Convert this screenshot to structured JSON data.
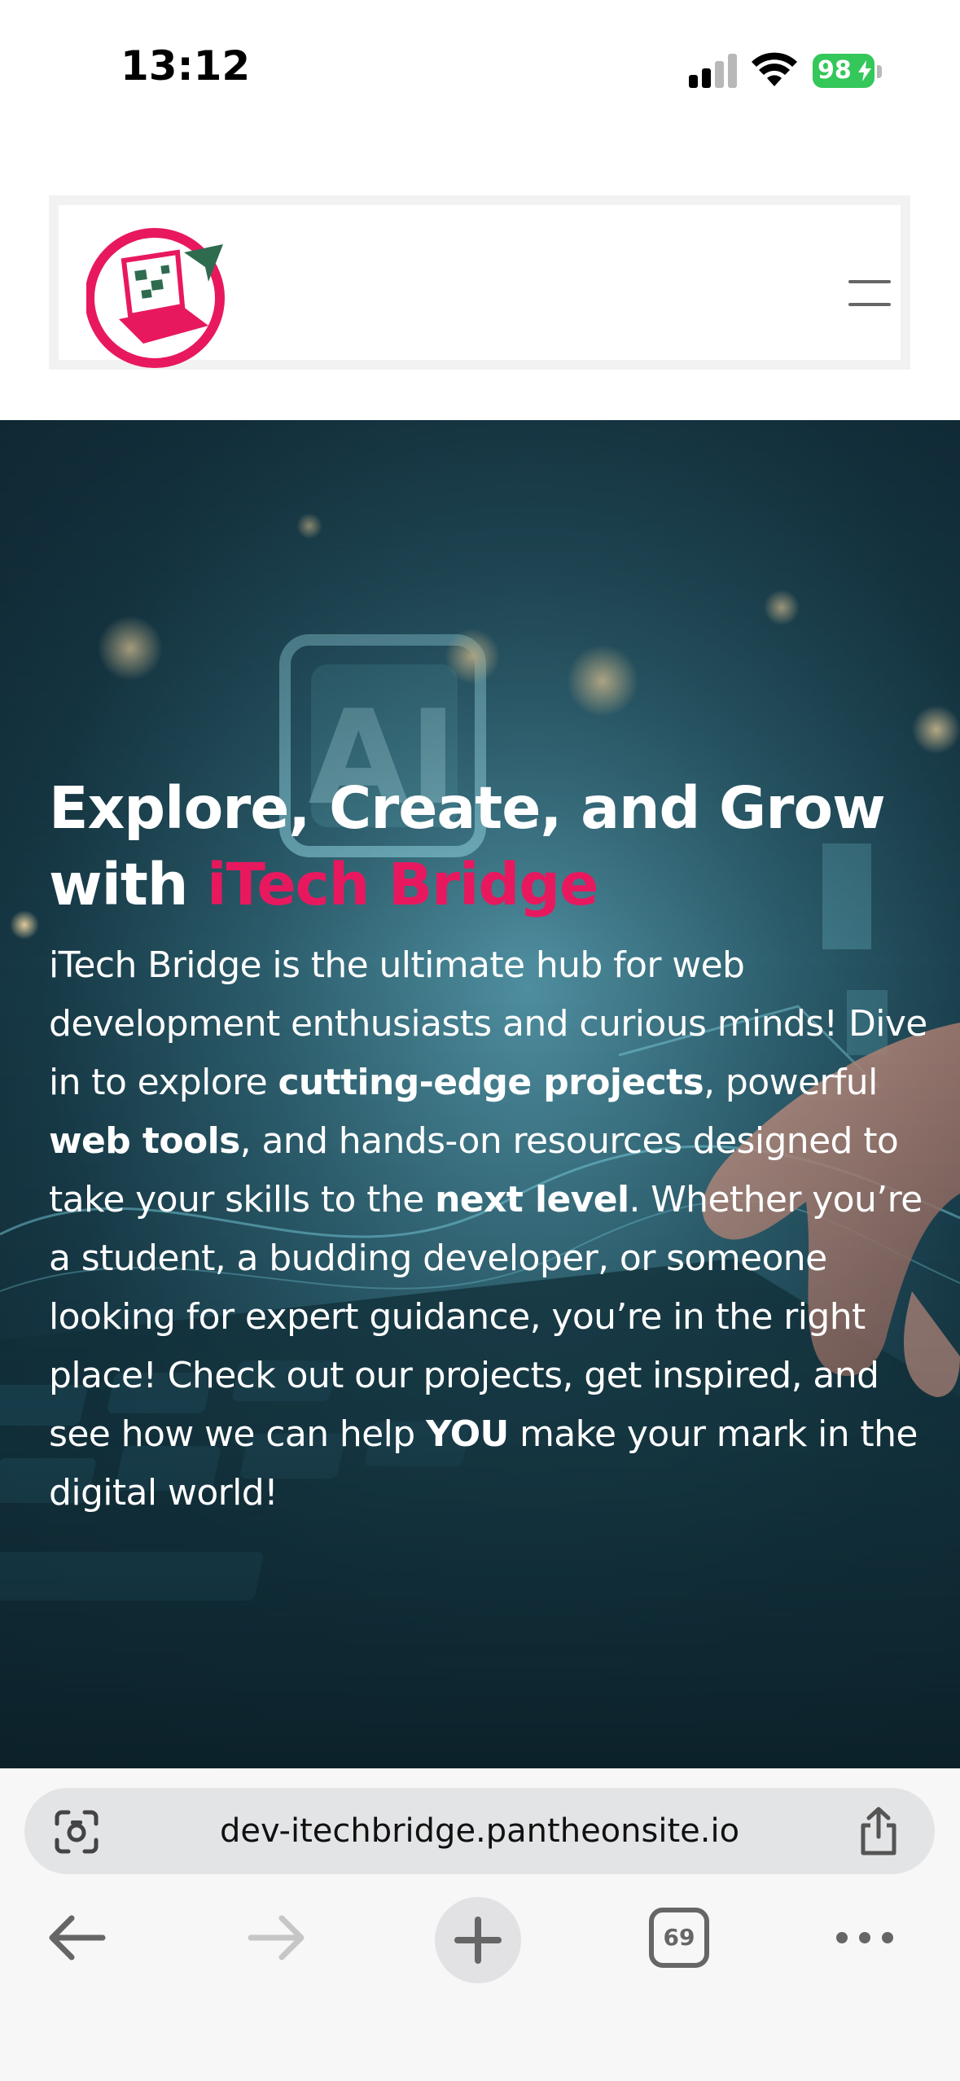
{
  "status_bar": {
    "time": "13:12",
    "battery": "98"
  },
  "header": {
    "logo": "itech-bridge-logo",
    "menu_icon": "hamburger-icon"
  },
  "hero": {
    "title_line1": "Explore, Create, and Grow",
    "title_with": "with ",
    "title_brand": "iTech Bridge",
    "description": [
      {
        "text": "iTech Bridge is the ultimate hub for web development enthusiasts and curious minds! Dive in to explore ",
        "bold": false
      },
      {
        "text": "cutting-edge projects",
        "bold": true
      },
      {
        "text": ", powerful ",
        "bold": false
      },
      {
        "text": "web tools",
        "bold": true
      },
      {
        "text": ", and hands-on resources designed to take your skills to the ",
        "bold": false
      },
      {
        "text": "next level",
        "bold": true
      },
      {
        "text": ". Whether you’re a student, a budding developer, or someone looking for expert guidance, you’re in the right place! Check out our projects, get inspired, and see how we can help ",
        "bold": false
      },
      {
        "text": "YOU",
        "bold": true
      },
      {
        "text": " make your mark in the digital world!",
        "bold": false
      }
    ]
  },
  "browser": {
    "url": "dev-itechbridge.pantheonsite.io",
    "tab_count": "69",
    "icons": [
      "scan-icon",
      "share-icon",
      "back-arrow-icon",
      "forward-arrow-icon",
      "new-tab-icon",
      "tabs-icon",
      "more-icon"
    ]
  },
  "colors": {
    "brand_pink": "#e8185f",
    "brand_green": "#2e6b4f",
    "battery_green": "#34c759"
  }
}
